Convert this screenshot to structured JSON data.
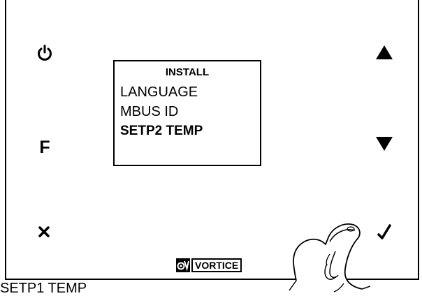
{
  "screen": {
    "title": "INSTALL",
    "items": [
      "LANGUAGE",
      "MBUS ID",
      "SETP2 TEMP"
    ],
    "selected_index": 2
  },
  "buttons": {
    "power_icon": "power-icon",
    "function_label": "F",
    "cancel_icon": "close-icon",
    "up_icon": "triangle-up-icon",
    "down_icon": "triangle-down-icon",
    "confirm_icon": "check-icon"
  },
  "logo": {
    "text": "VORTICE"
  },
  "caption": "SETP1 TEMP"
}
